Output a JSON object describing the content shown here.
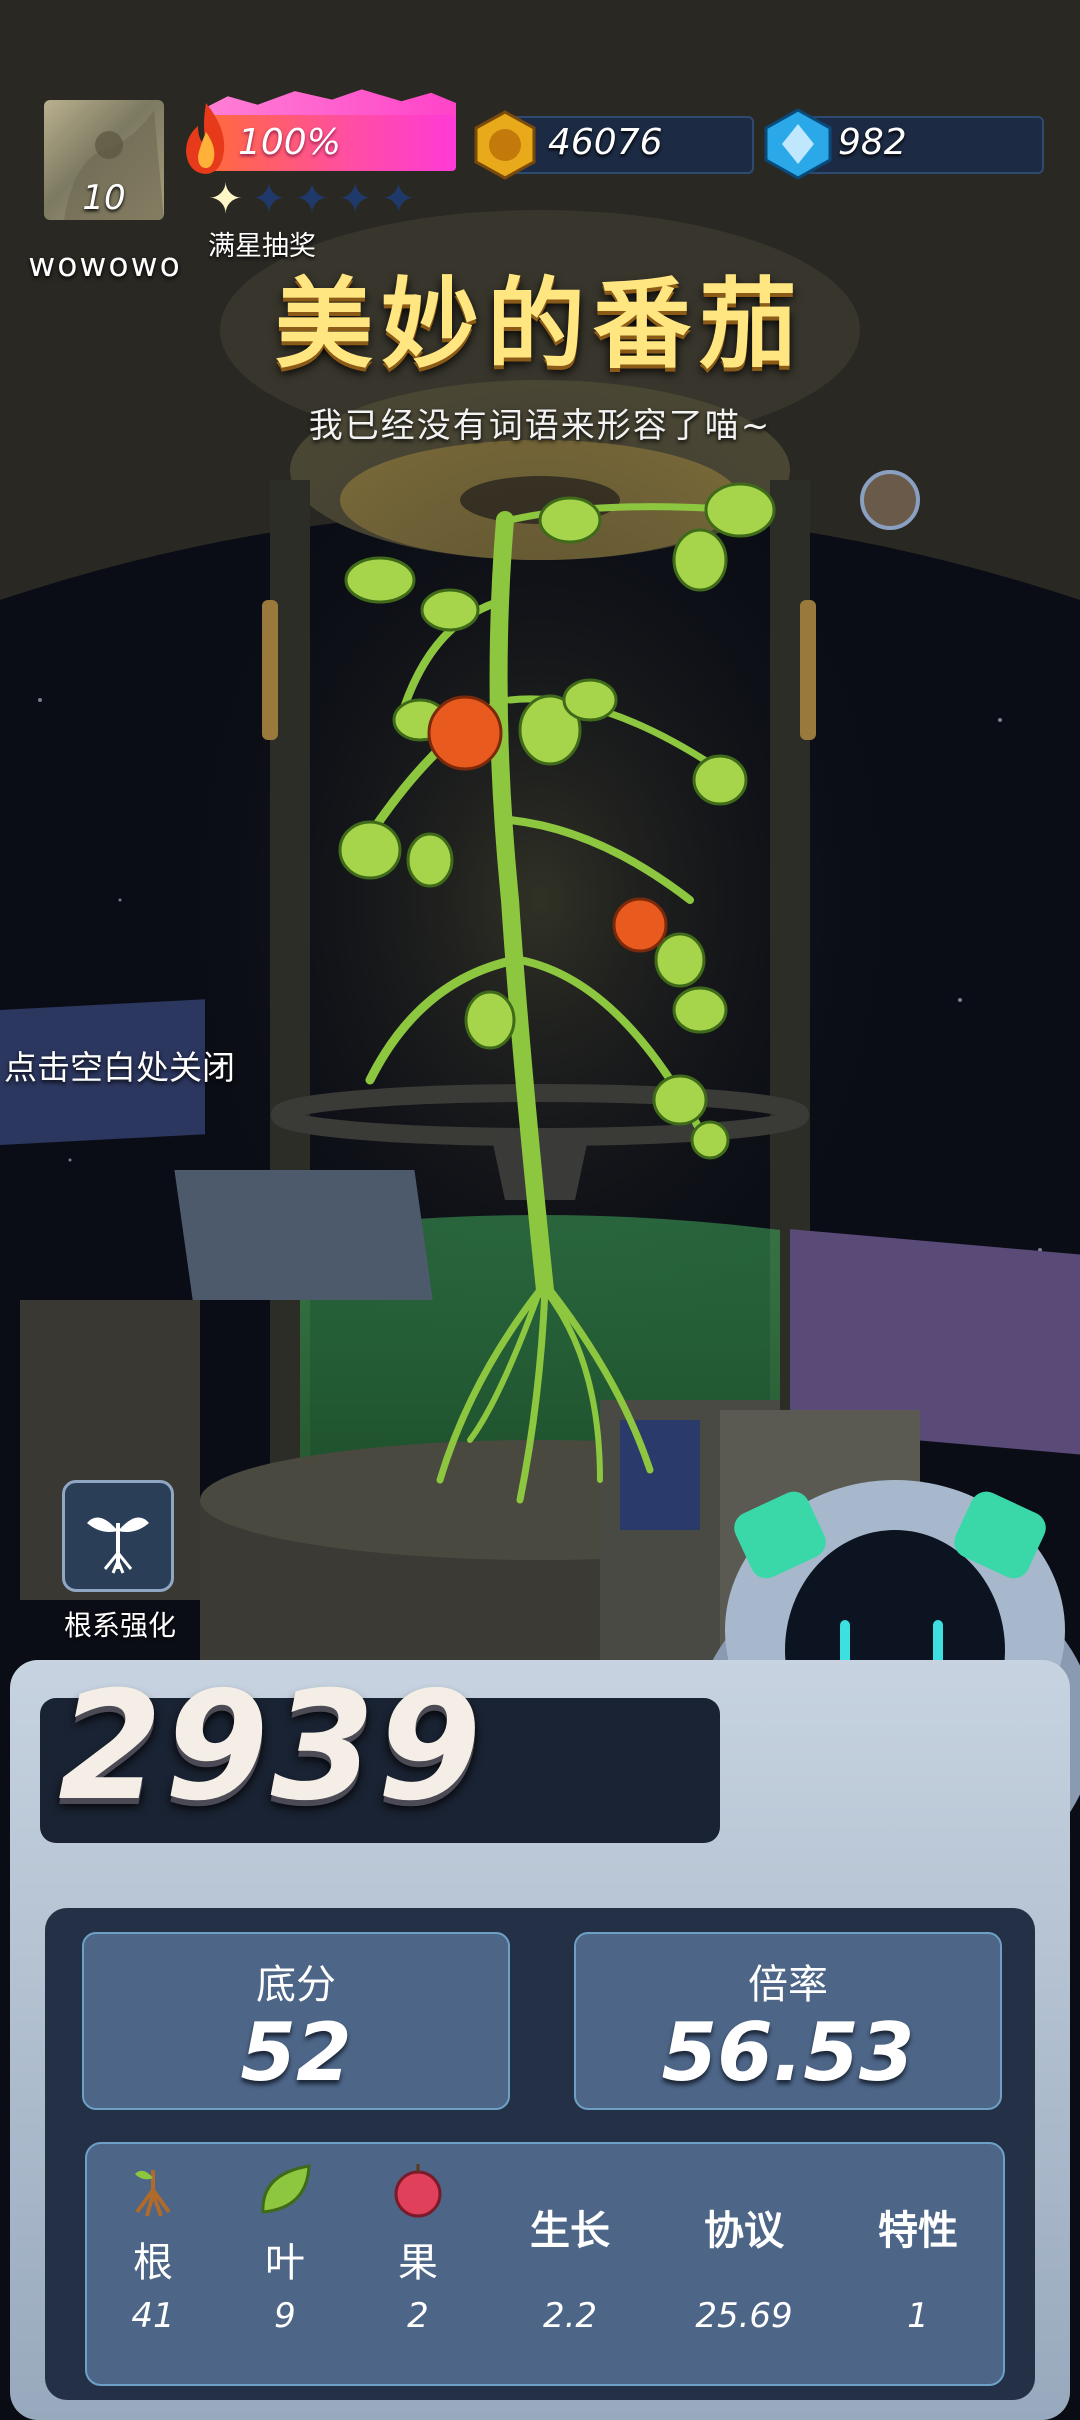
{
  "player": {
    "name": "wowowo",
    "level": "10"
  },
  "energy": {
    "percent_label": "100%",
    "fill": 1.0,
    "stars_total": 5,
    "stars_filled": 1,
    "stars_label": "满星抽奖"
  },
  "currency": {
    "coins": "46076",
    "gems": "982"
  },
  "plant": {
    "title": "美妙的番茄",
    "subtitle": "我已经没有词语来形容了喵~"
  },
  "hint": {
    "close": "点击空白处关闭"
  },
  "root_upgrade": {
    "label": "根系强化"
  },
  "score": {
    "total": "2939"
  },
  "stats": {
    "base": {
      "label": "底分",
      "value": "52"
    },
    "multiplier": {
      "label": "倍率",
      "value": "56.53"
    }
  },
  "table": [
    {
      "label": "根",
      "value": "41",
      "icon": "root-icon"
    },
    {
      "label": "叶",
      "value": "9",
      "icon": "leaf-icon"
    },
    {
      "label": "果",
      "value": "2",
      "icon": "apple-icon"
    },
    {
      "label": "生长",
      "value": "2.2",
      "icon": ""
    },
    {
      "label": "协议",
      "value": "25.69",
      "icon": ""
    },
    {
      "label": "特性",
      "value": "1",
      "icon": ""
    }
  ],
  "colors": {
    "title": "#ffe680",
    "energy_start": "#ff6a3c",
    "energy_end": "#ff3ad7",
    "panel": "#4d6587"
  }
}
